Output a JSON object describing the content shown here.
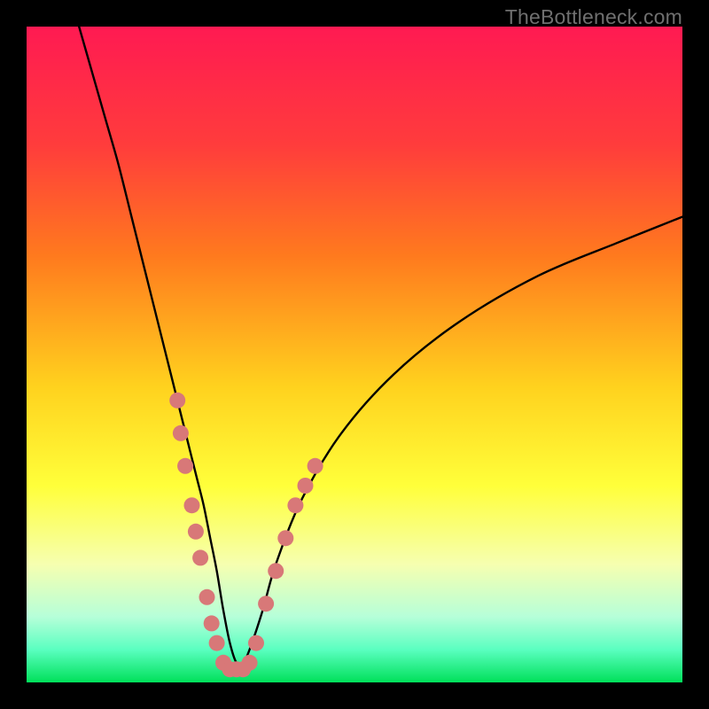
{
  "watermark": "TheBottleneck.com",
  "chart_data": {
    "type": "line",
    "title": "",
    "xlabel": "",
    "ylabel": "",
    "xlim": [
      0,
      100
    ],
    "ylim": [
      0,
      100
    ],
    "grid": false,
    "legend": false,
    "background": {
      "type": "vertical-gradient",
      "stops": [
        {
          "pos": 0.0,
          "color": "#ff1a52"
        },
        {
          "pos": 0.18,
          "color": "#ff3c3c"
        },
        {
          "pos": 0.35,
          "color": "#ff7a1e"
        },
        {
          "pos": 0.55,
          "color": "#ffd21e"
        },
        {
          "pos": 0.7,
          "color": "#ffff3a"
        },
        {
          "pos": 0.82,
          "color": "#f6ffb0"
        },
        {
          "pos": 0.9,
          "color": "#b6ffd9"
        },
        {
          "pos": 0.95,
          "color": "#5affc0"
        },
        {
          "pos": 1.0,
          "color": "#00e05a"
        }
      ]
    },
    "series": [
      {
        "name": "bottleneck-curve",
        "stroke": "#000000",
        "stroke_width": 2.4,
        "x": [
          8,
          10,
          12,
          14,
          16,
          18,
          20,
          22,
          24,
          25,
          26,
          27,
          28,
          29,
          30,
          31,
          32,
          33,
          34,
          36,
          38,
          42,
          48,
          56,
          66,
          78,
          90,
          100
        ],
        "y": [
          100,
          93,
          86,
          79,
          71,
          63,
          55,
          47,
          39,
          35,
          31,
          27,
          22,
          17,
          11,
          6,
          3,
          3,
          5,
          11,
          18,
          28,
          38,
          47,
          55,
          62,
          67,
          71
        ]
      }
    ],
    "markers": {
      "name": "sample-points",
      "color": "#d87878",
      "radius": 9,
      "points": [
        {
          "x": 23.0,
          "y": 43
        },
        {
          "x": 23.5,
          "y": 38
        },
        {
          "x": 24.2,
          "y": 33
        },
        {
          "x": 25.2,
          "y": 27
        },
        {
          "x": 25.8,
          "y": 23
        },
        {
          "x": 26.5,
          "y": 19
        },
        {
          "x": 27.5,
          "y": 13
        },
        {
          "x": 28.2,
          "y": 9
        },
        {
          "x": 29.0,
          "y": 6
        },
        {
          "x": 30.0,
          "y": 3
        },
        {
          "x": 31.0,
          "y": 2
        },
        {
          "x": 32.0,
          "y": 2
        },
        {
          "x": 33.0,
          "y": 2
        },
        {
          "x": 34.0,
          "y": 3
        },
        {
          "x": 35.0,
          "y": 6
        },
        {
          "x": 36.5,
          "y": 12
        },
        {
          "x": 38.0,
          "y": 17
        },
        {
          "x": 39.5,
          "y": 22
        },
        {
          "x": 41.0,
          "y": 27
        },
        {
          "x": 42.5,
          "y": 30
        },
        {
          "x": 44.0,
          "y": 33
        }
      ]
    }
  }
}
